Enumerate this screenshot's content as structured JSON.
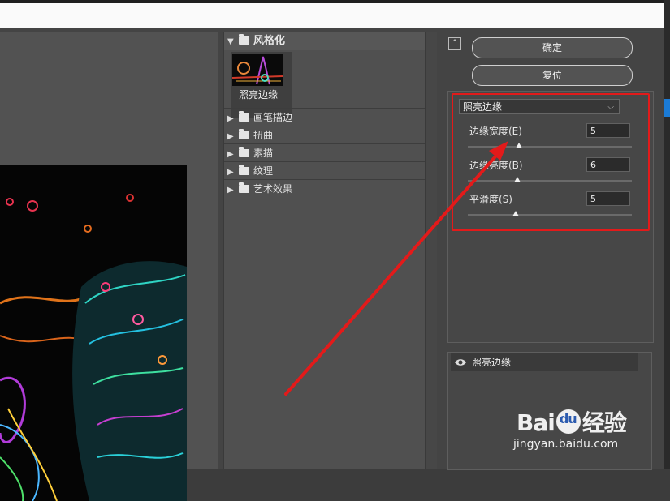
{
  "gallery": {
    "group_title": "风格化",
    "thumbnail_label": "照亮边缘",
    "categories": [
      "画笔描边",
      "扭曲",
      "素描",
      "纹理",
      "艺术效果"
    ]
  },
  "controls": {
    "ok_label": "确定",
    "reset_label": "复位",
    "filter_select": "照亮边缘",
    "params": [
      {
        "label": "边缘宽度(E)",
        "value": "5",
        "slider_fraction": 0.31
      },
      {
        "label": "边缘亮度(B)",
        "value": "6",
        "slider_fraction": 0.3
      },
      {
        "label": "平滑度(S)",
        "value": "5",
        "slider_fraction": 0.29
      }
    ]
  },
  "layers": {
    "item_label": "照亮边缘"
  },
  "watermark": {
    "brand_left": "Bai",
    "brand_right": "经验",
    "url": "jingyan.baidu.com"
  },
  "colors": {
    "annotation_red": "#e31a1a",
    "panel_bg": "#444444"
  }
}
